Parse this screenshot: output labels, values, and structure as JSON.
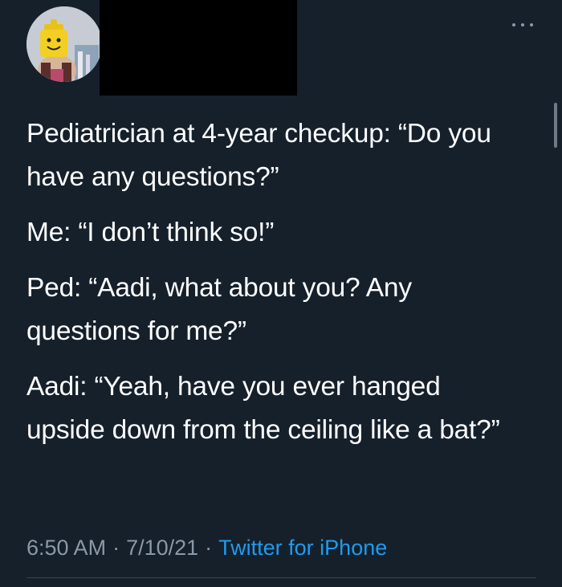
{
  "tweet": {
    "author_avatar": "lego-head-avatar",
    "more_icon": "more-horizontal-icon",
    "paragraphs": [
      "Pediatrician at 4-year checkup: “Do you have any questions?”",
      "Me: “I don’t think so!”",
      "Ped: “Aadi, what about you? Any questions for me?”",
      "Aadi: “Yeah, have you ever hanged upside down from the ceiling like a bat?”"
    ],
    "time": "6:50 AM",
    "separator": "·",
    "date": "7/10/21",
    "source": "Twitter for iPhone"
  },
  "colors": {
    "background": "#15202b",
    "text": "#ffffff",
    "meta": "#8b98a5",
    "link": "#1d9bf0",
    "divider": "#38444d"
  }
}
